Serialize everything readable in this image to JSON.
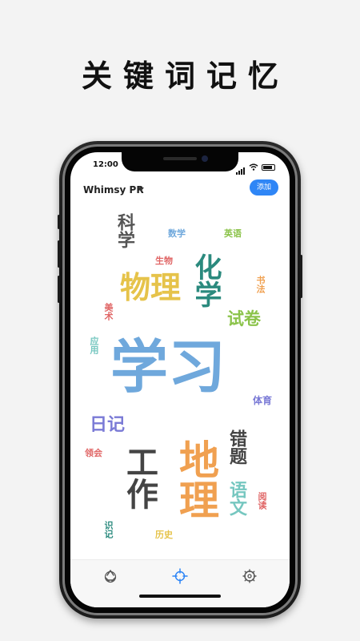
{
  "promo": {
    "headline": "关键词记忆"
  },
  "status_bar": {
    "time": "12:00"
  },
  "header": {
    "user_name": "Whimsy PR",
    "add_label": "添加"
  },
  "word_cloud": [
    {
      "text": "科学",
      "color": "#555555"
    },
    {
      "text": "数学",
      "color": "#6fa8dc"
    },
    {
      "text": "英语",
      "color": "#8bc34a"
    },
    {
      "text": "生物",
      "color": "#e06666"
    },
    {
      "text": "物理",
      "color": "#e6c34a"
    },
    {
      "text": "化学",
      "color": "#2b8a7e"
    },
    {
      "text": "书法",
      "color": "#f0a050"
    },
    {
      "text": "美术",
      "color": "#e06666"
    },
    {
      "text": "试卷",
      "color": "#8bc34a"
    },
    {
      "text": "应用",
      "color": "#76c7c0"
    },
    {
      "text": "学习",
      "color": "#6fa8dc"
    },
    {
      "text": "体育",
      "color": "#7a7ad6"
    },
    {
      "text": "日记",
      "color": "#7a7ad6"
    },
    {
      "text": "错题",
      "color": "#444444"
    },
    {
      "text": "领会",
      "color": "#e06666"
    },
    {
      "text": "工作",
      "color": "#444444"
    },
    {
      "text": "地理",
      "color": "#f0a050"
    },
    {
      "text": "语文",
      "color": "#76c7c0"
    },
    {
      "text": "阅读",
      "color": "#e06666"
    },
    {
      "text": "识记",
      "color": "#2b8a7e"
    },
    {
      "text": "历史",
      "color": "#e6c34a"
    }
  ],
  "tab_bar": {
    "active_color": "#2f86f6",
    "inactive_color": "#555555"
  }
}
